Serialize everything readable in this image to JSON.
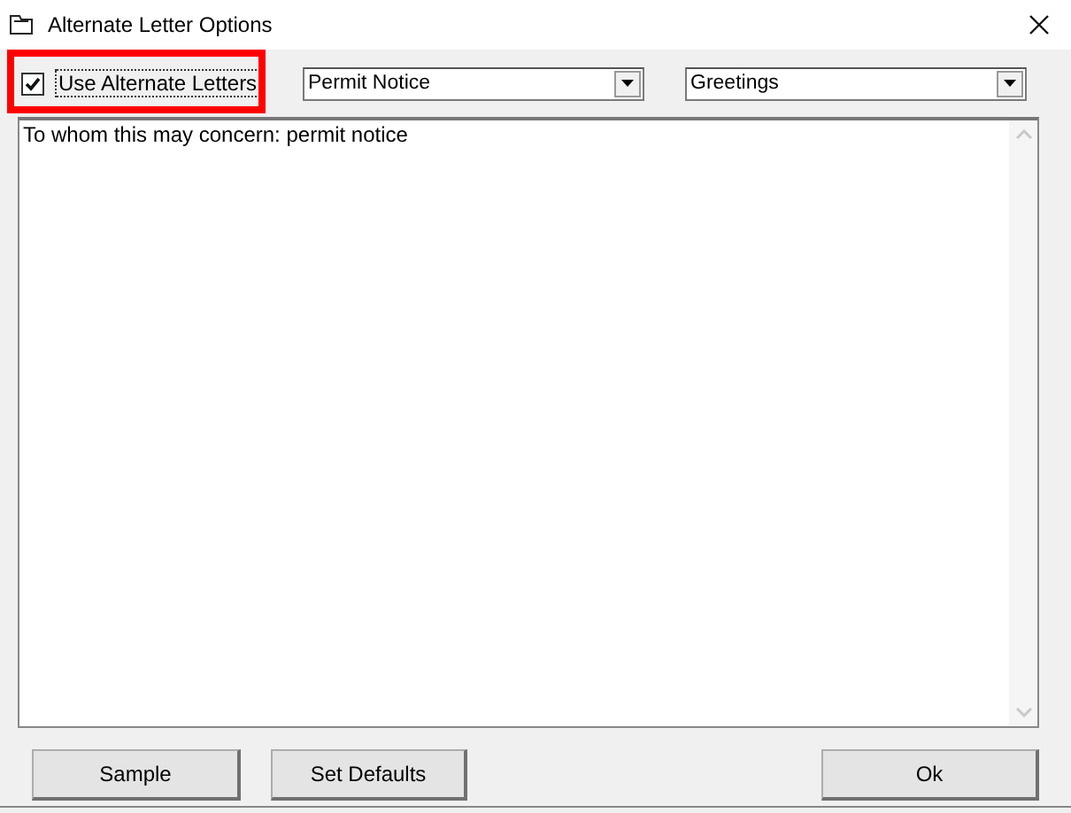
{
  "window": {
    "title": "Alternate Letter Options"
  },
  "checkbox": {
    "label": "Use Alternate Letters",
    "checked": true,
    "highlighted": true
  },
  "dropdowns": [
    {
      "value": "Permit Notice"
    },
    {
      "value": "Greetings"
    }
  ],
  "text_area": {
    "value": "To whom this may concern: permit notice"
  },
  "buttons": [
    {
      "label": "Sample"
    },
    {
      "label": "Set Defaults"
    },
    {
      "label": "Ok"
    }
  ]
}
